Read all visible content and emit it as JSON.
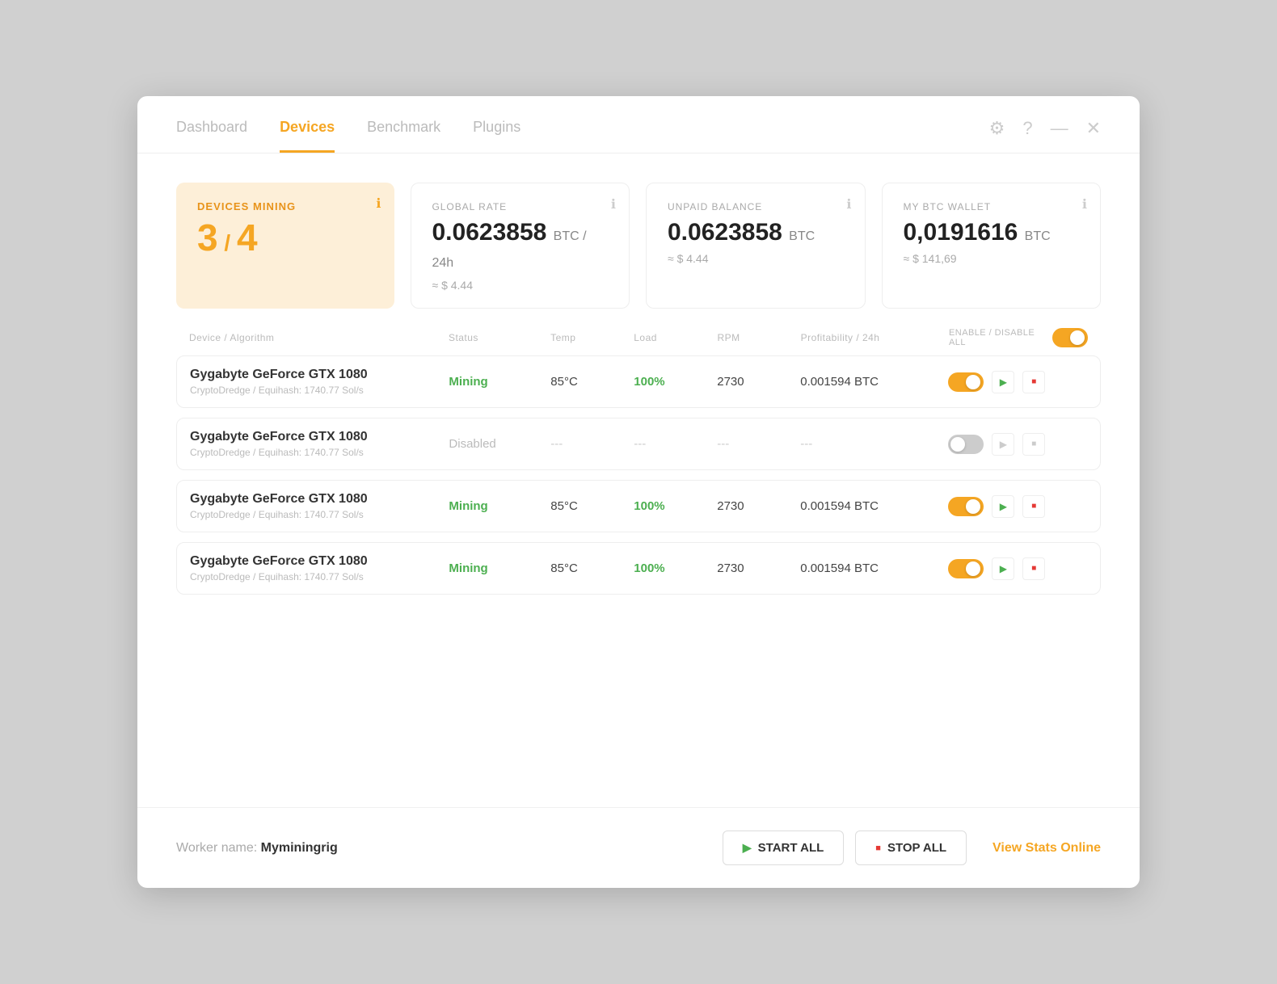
{
  "nav": {
    "tabs": [
      {
        "id": "dashboard",
        "label": "Dashboard",
        "active": false
      },
      {
        "id": "devices",
        "label": "Devices",
        "active": true
      },
      {
        "id": "benchmark",
        "label": "Benchmark",
        "active": false
      },
      {
        "id": "plugins",
        "label": "Plugins",
        "active": false
      }
    ]
  },
  "controls": {
    "settings_icon": "⚙",
    "help_icon": "?",
    "minimize_icon": "—",
    "close_icon": "✕"
  },
  "stats": {
    "devices_mining": {
      "label": "DEVICES MINING",
      "count": "3",
      "total": "4"
    },
    "global_rate": {
      "label": "GLOBAL RATE",
      "value": "0.0623858",
      "unit": "BTC",
      "period": "/ 24h",
      "sub": "≈ $ 4.44"
    },
    "unpaid_balance": {
      "label": "UNPAID BALANCE",
      "value": "0.0623858",
      "unit": "BTC",
      "sub": "≈ $ 4.44"
    },
    "btc_wallet": {
      "label": "MY BTC WALLET",
      "value": "0,0191616",
      "unit": "BTC",
      "sub": "≈ $ 141,69"
    }
  },
  "table": {
    "headers": {
      "device": "Device / Algorithm",
      "status": "Status",
      "temp": "Temp",
      "load": "Load",
      "rpm": "RPM",
      "profit": "Profitability / 24h",
      "enable_disable": "ENABLE / DISABLE ALL"
    },
    "rows": [
      {
        "id": 1,
        "device_name": "Gygabyte GeForce GTX 1080",
        "algorithm": "CryptoDredge / Equihash: 1740.77 Sol/s",
        "status": "Mining",
        "status_type": "mining",
        "temp": "85°C",
        "load": "100%",
        "rpm": "2730",
        "profit": "0.001594 BTC",
        "enabled": true
      },
      {
        "id": 2,
        "device_name": "Gygabyte GeForce GTX 1080",
        "algorithm": "CryptoDredge / Equihash: 1740.77 Sol/s",
        "status": "Disabled",
        "status_type": "disabled",
        "temp": "---",
        "load": "---",
        "rpm": "---",
        "profit": "---",
        "enabled": false
      },
      {
        "id": 3,
        "device_name": "Gygabyte GeForce GTX 1080",
        "algorithm": "CryptoDredge / Equihash: 1740.77 Sol/s",
        "status": "Mining",
        "status_type": "mining",
        "temp": "85°C",
        "load": "100%",
        "rpm": "2730",
        "profit": "0.001594 BTC",
        "enabled": true
      },
      {
        "id": 4,
        "device_name": "Gygabyte GeForce GTX 1080",
        "algorithm": "CryptoDredge / Equihash: 1740.77 Sol/s",
        "status": "Mining",
        "status_type": "mining",
        "temp": "85°C",
        "load": "100%",
        "rpm": "2730",
        "profit": "0.001594 BTC",
        "enabled": true
      }
    ]
  },
  "footer": {
    "worker_label": "Worker name:",
    "worker_name": "Myminingrig",
    "start_all": "START ALL",
    "stop_all": "STOP ALL",
    "view_stats": "View Stats Online"
  }
}
